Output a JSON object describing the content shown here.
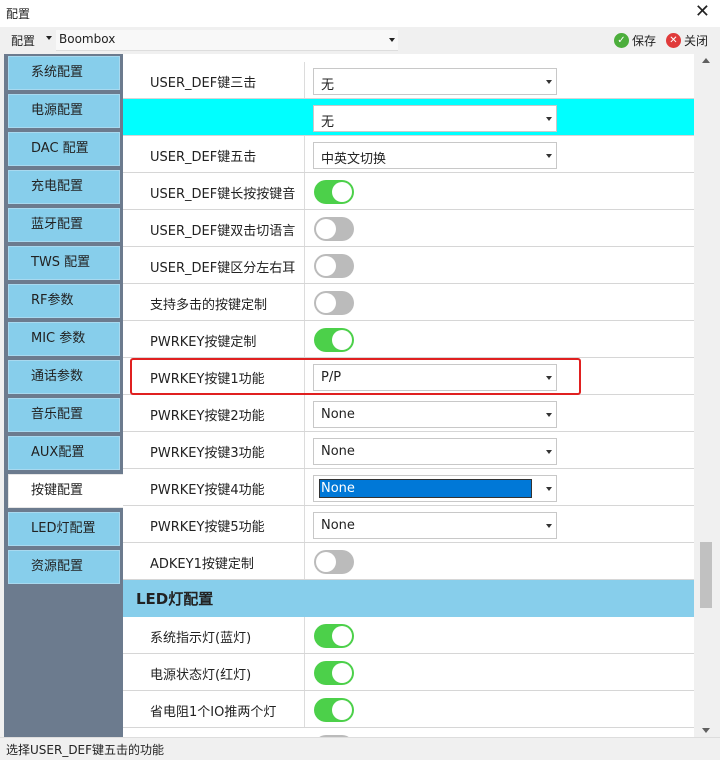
{
  "window": {
    "title": "配置"
  },
  "toolbar": {
    "config_menu": "配置",
    "profile": "Boombox",
    "save_label": "保存",
    "close_label": "关闭"
  },
  "sidebar": {
    "items": [
      {
        "label": "系统配置"
      },
      {
        "label": "电源配置"
      },
      {
        "label": "DAC 配置"
      },
      {
        "label": "充电配置"
      },
      {
        "label": "蓝牙配置"
      },
      {
        "label": "TWS 配置"
      },
      {
        "label": "RF参数"
      },
      {
        "label": "MIC 参数"
      },
      {
        "label": "通话参数"
      },
      {
        "label": "音乐配置"
      },
      {
        "label": "AUX配置"
      },
      {
        "label": "按键配置",
        "active": true
      },
      {
        "label": "LED灯配置"
      },
      {
        "label": "资源配置"
      }
    ]
  },
  "rows": [
    {
      "label": "USER_DEF键三击",
      "type": "combo",
      "value": "无"
    },
    {
      "label": "",
      "type": "combo",
      "value": "无",
      "highlight": true
    },
    {
      "label": "USER_DEF键五击",
      "type": "combo",
      "value": "中英文切换"
    },
    {
      "label": "USER_DEF键长按按键音",
      "type": "toggle",
      "on": true
    },
    {
      "label": "USER_DEF键双击切语言",
      "type": "toggle",
      "on": false
    },
    {
      "label": "USER_DEF键区分左右耳",
      "type": "toggle",
      "on": false
    },
    {
      "label": "支持多击的按键定制",
      "type": "toggle",
      "on": false
    },
    {
      "label": "PWRKEY按键定制",
      "type": "toggle",
      "on": true
    },
    {
      "label": "PWRKEY按键1功能",
      "type": "combo",
      "value": "P/P"
    },
    {
      "label": "PWRKEY按键2功能",
      "type": "combo",
      "value": "None"
    },
    {
      "label": "PWRKEY按键3功能",
      "type": "combo",
      "value": "None"
    },
    {
      "label": "PWRKEY按键4功能",
      "type": "combo",
      "value": "None",
      "selected": true
    },
    {
      "label": "PWRKEY按键5功能",
      "type": "combo",
      "value": "None"
    },
    {
      "label": "ADKEY1按键定制",
      "type": "toggle",
      "on": false
    }
  ],
  "section": {
    "label": "LED灯配置"
  },
  "led_rows": [
    {
      "label": "系统指示灯(蓝灯)",
      "type": "toggle",
      "on": true
    },
    {
      "label": "电源状态灯(红灯)",
      "type": "toggle",
      "on": true
    },
    {
      "label": "省电阻1个IO推两个灯",
      "type": "toggle",
      "on": true
    }
  ],
  "status": {
    "text": "选择USER_DEF键五击的功能"
  },
  "colors": {
    "accent": "#87ceeb",
    "highlight": "#00ffff",
    "toggle_on": "#4cd04a",
    "toggle_off": "#bbbbbb",
    "selection": "#0078d7",
    "callout": "#e02020"
  }
}
